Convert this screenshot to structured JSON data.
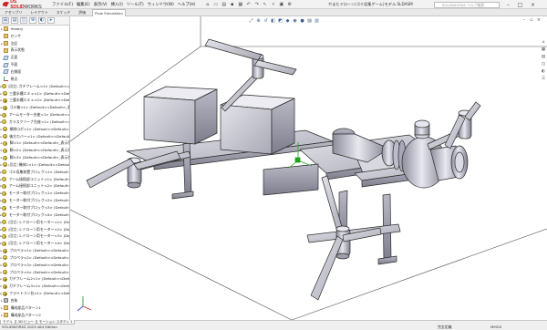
{
  "app": {
    "logo_text_a": "DS SOLID",
    "logo_text_b": "WORKS",
    "menus": [
      "ファイル(F)",
      "編集(E)",
      "表示(V)",
      "挿入(I)",
      "ツール(T)",
      "ウィンドウ(W)",
      "ヘルプ(H)"
    ],
    "doc_title": "やまだドローン(ゴミ収集ゲーム)モデル.SLDASM",
    "search_placeholder": "SOLIDWORKS ヘルプ検索"
  },
  "command_tabs": [
    "アセンブリ",
    "レイアウト",
    "スケッチ",
    "評価",
    "Flow Simulation"
  ],
  "active_command_tab": "Flow Simulation",
  "feature_tree": [
    {
      "expand": "▸",
      "icon": "folder",
      "pre": "",
      "label": "History"
    },
    {
      "expand": "",
      "icon": "folder",
      "pre": "",
      "label": "センサ"
    },
    {
      "expand": "▸",
      "icon": "folder",
      "pre": "",
      "label": "注記"
    },
    {
      "expand": "",
      "icon": "folder",
      "pre": "",
      "label": "表示状態"
    },
    {
      "expand": "",
      "icon": "plane",
      "pre": "",
      "label": "正面"
    },
    {
      "expand": "",
      "icon": "plane",
      "pre": "",
      "label": "平面"
    },
    {
      "expand": "",
      "icon": "plane",
      "pre": "",
      "label": "右側面"
    },
    {
      "expand": "",
      "icon": "origin",
      "pre": "",
      "label": "原点"
    },
    {
      "expand": "▸",
      "icon": "part",
      "pre": "(固定)",
      "label": "ガチフレーム<1> (Default<<Default>_表示状態 1>)"
    },
    {
      "expand": "▸",
      "icon": "part",
      "pre": "",
      "label": "三重水槽エミュ<1> (Default<<Default>_表示状態 1>)"
    },
    {
      "expand": "▸",
      "icon": "part",
      "pre": "",
      "label": "三重水槽エミュ<2> (Default<<Default>_表示状態 1>)"
    },
    {
      "expand": "▸",
      "icon": "part",
      "pre": "",
      "label": "ゴミ箱<1> (Default<<Default>_表示状態 1>)"
    },
    {
      "expand": "▸",
      "icon": "part",
      "pre": "",
      "label": "アームモーター台座<1> (Default<<Default>_表示状態 1>)"
    },
    {
      "expand": "▸",
      "icon": "part",
      "pre": "",
      "label": "ガラスクリーナ台座<1> (Default<<Default>_表示状態 1>)"
    },
    {
      "expand": "▸",
      "icon": "part",
      "pre": "",
      "label": "掃除ロボ<1> (Default<<Default>_表示状態 1>)"
    },
    {
      "expand": "▸",
      "icon": "part",
      "pre": "",
      "label": "後方カバー<1> (Default<<Default>_表示状態 1>)"
    },
    {
      "expand": "▸",
      "icon": "part",
      "pre": "",
      "label": "脚<1> (Default<<Default>_表示状態 1>)"
    },
    {
      "expand": "▸",
      "icon": "part",
      "pre": "",
      "label": "脚<2> (Default<<Default>_表示状態 1>)"
    },
    {
      "expand": "▸",
      "icon": "part",
      "pre": "",
      "label": "脚<3> (Default<<Default>_表示状態 1>)"
    },
    {
      "expand": "▸",
      "icon": "part",
      "pre": "(固定)",
      "label": "機体1<1> (Default<<Default>_表示状態 1>)"
    },
    {
      "expand": "▸",
      "icon": "part",
      "pre": "",
      "label": "ゴミ収集装置ブロック<1> (Default<<Default>_表示状態 1>)"
    },
    {
      "expand": "▸",
      "icon": "part",
      "pre": "",
      "label": "アーム接続部ユニット<1> (Default<<Default>_表示状態 1>)"
    },
    {
      "expand": "▸",
      "icon": "part",
      "pre": "",
      "label": "アーム接続部ユニット<2> (Default<<Default>_表示状態 1>)"
    },
    {
      "expand": "▸",
      "icon": "part",
      "pre": "",
      "label": "モーター取付ブロック<1> (Default<<Default>_表示状態 1>)"
    },
    {
      "expand": "▸",
      "icon": "part",
      "pre": "",
      "label": "モーター取付ブロック<2> (Default<<Default>_表示状態 1>)"
    },
    {
      "expand": "▸",
      "icon": "part",
      "pre": "",
      "label": "モーター取付ブロック<3> (Default<<Default>_表示状態 1>)"
    },
    {
      "expand": "▸",
      "icon": "part",
      "pre": "",
      "label": "モーター取付ブロック<4> (Default<<Default>_表示状態 1>)"
    },
    {
      "expand": "▸",
      "icon": "part",
      "pre": "(固定)",
      "label": "1-ドローン用モーター<1> (Default<<Default>>)"
    },
    {
      "expand": "▸",
      "icon": "part",
      "pre": "(固定)",
      "label": "1-ドローン用モーター<2> (Default<<Default>>)"
    },
    {
      "expand": "▸",
      "icon": "part",
      "pre": "(固定)",
      "label": "1-ドローン用モーター<3> (Default<<Default>>)"
    },
    {
      "expand": "▸",
      "icon": "part",
      "pre": "(固定)",
      "label": "1-ドローン用モーター<4> (Default<<Default>>)"
    },
    {
      "expand": "▸",
      "icon": "part",
      "pre": "",
      "label": "プロペラ<1> (Default<<Default>_表示状態 1>)"
    },
    {
      "expand": "▸",
      "icon": "part",
      "pre": "",
      "label": "プロペラ<2> (Default<<Default>_表示状態 1>)"
    },
    {
      "expand": "▸",
      "icon": "part",
      "pre": "",
      "label": "プロペラ<3> (Default<<Default>_表示状態 1>)"
    },
    {
      "expand": "▸",
      "icon": "part",
      "pre": "",
      "label": "プロペラ<4> (Default<<Default>_表示状態 1>)"
    },
    {
      "expand": "▸",
      "icon": "part",
      "pre": "",
      "label": "ガチフレーム2<1> (Default<<Default>_表示状態 1>)"
    },
    {
      "expand": "▸",
      "icon": "part",
      "pre": "",
      "label": "ガチフレーム3<1> (Default<<Default>_表示状態 1>)"
    },
    {
      "expand": "▸",
      "icon": "part",
      "pre": "",
      "label": "フライトコン台<1> (Default<<Default>_表示状態 1>)"
    },
    {
      "expand": "▸",
      "icon": "mate",
      "pre": "",
      "label": "合致"
    },
    {
      "expand": "▸",
      "icon": "folder",
      "pre": "",
      "label": "構成部品パターン1"
    },
    {
      "expand": "▸",
      "icon": "folder",
      "pre": "",
      "label": "構成部品パターン2"
    }
  ],
  "model_tabs": [
    "モデル",
    "3D ビュー",
    "モーション スタディ 1"
  ],
  "status": {
    "left": "SOLIDWORKS 2019 x64 Edition",
    "mid": "完全定義",
    "units": "MMGS"
  },
  "colors": {
    "accent_red": "#c81e1e",
    "model_body": "#c8c8d0",
    "model_edge": "#2b2b2b",
    "selection_green": "#1fa31f"
  }
}
